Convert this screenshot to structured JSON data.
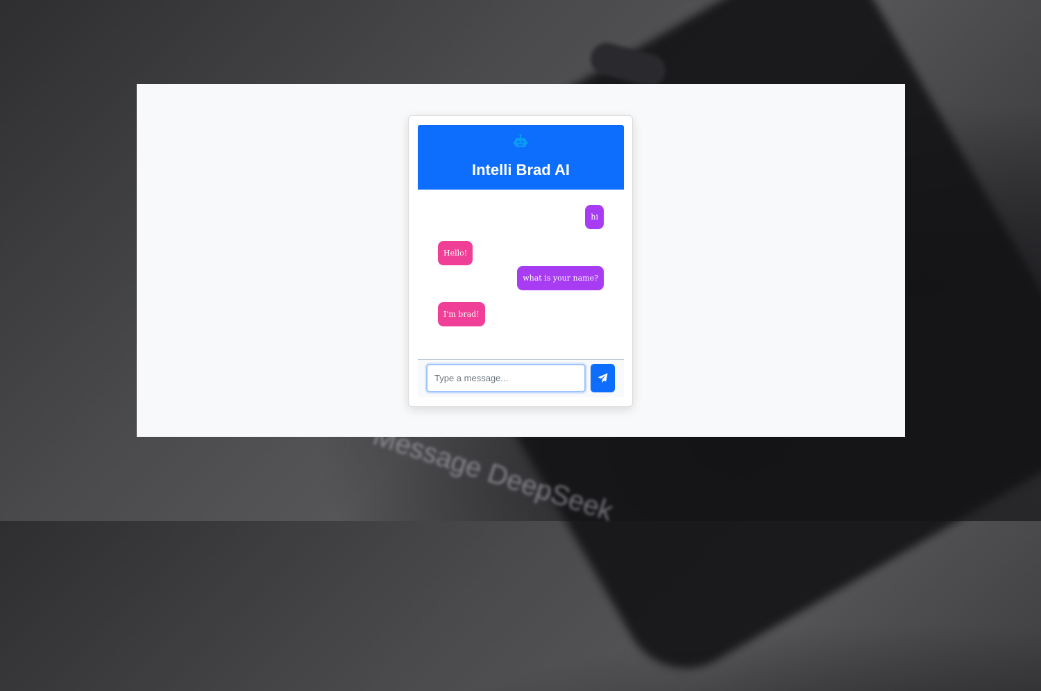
{
  "app": {
    "title": "Intelli Brad AI",
    "header_icon": "robot-icon",
    "accent_color": "#0d6efd"
  },
  "background": {
    "blurred_text": "Message DeepSeek"
  },
  "messages": [
    {
      "sender": "user",
      "text": "hi"
    },
    {
      "sender": "bot",
      "text": "Hello!"
    },
    {
      "sender": "user",
      "text": "what is your name?"
    },
    {
      "sender": "bot",
      "text": "I'm brad!"
    }
  ],
  "colors": {
    "user_bubble": "#a73cf2",
    "bot_bubble": "#f03f97"
  },
  "composer": {
    "placeholder": "Type a message...",
    "value": "",
    "send_icon": "paper-plane-icon"
  }
}
